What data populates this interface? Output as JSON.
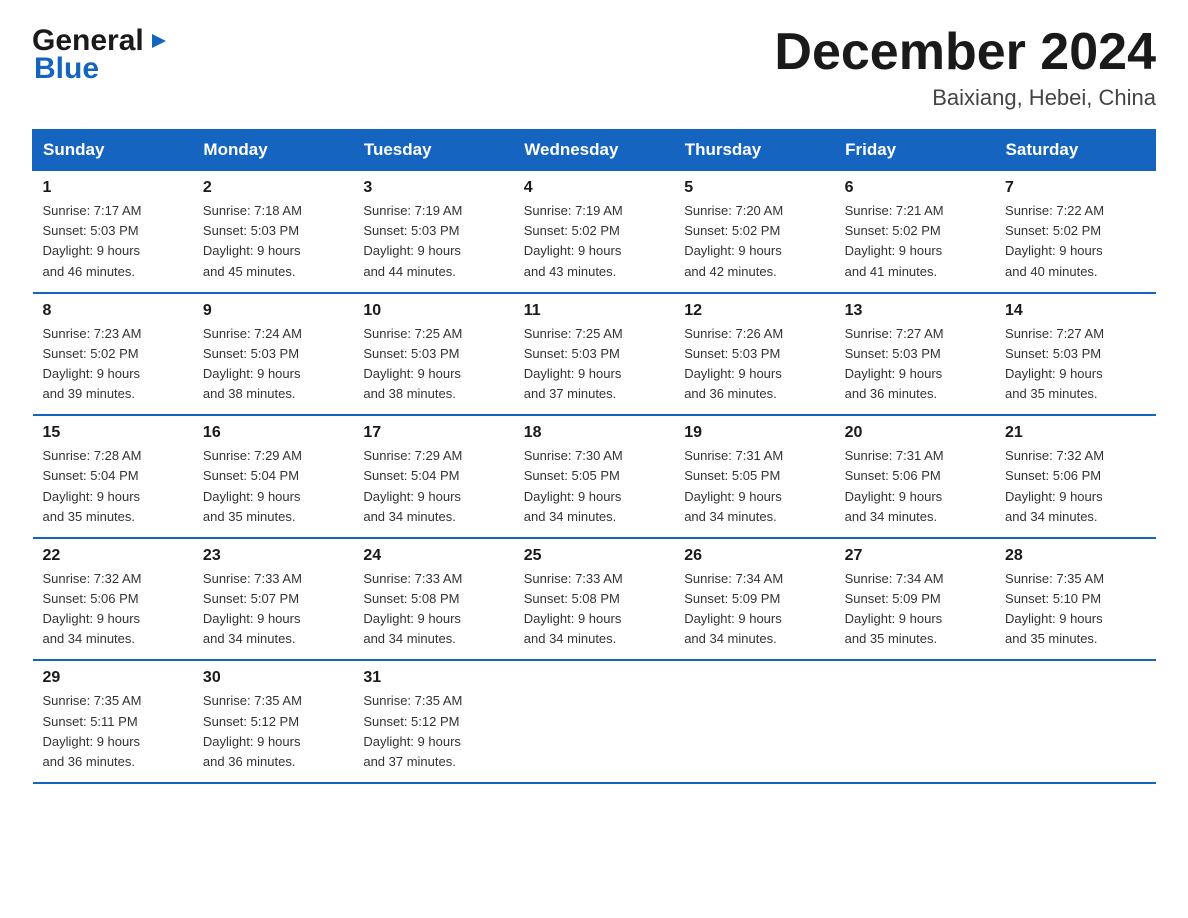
{
  "header": {
    "title": "December 2024",
    "subtitle": "Baixiang, Hebei, China"
  },
  "logo": {
    "general": "General",
    "blue": "Blue"
  },
  "calendar": {
    "headers": [
      "Sunday",
      "Monday",
      "Tuesday",
      "Wednesday",
      "Thursday",
      "Friday",
      "Saturday"
    ],
    "weeks": [
      [
        {
          "day": "1",
          "sunrise": "7:17 AM",
          "sunset": "5:03 PM",
          "daylight": "9 hours and 46 minutes."
        },
        {
          "day": "2",
          "sunrise": "7:18 AM",
          "sunset": "5:03 PM",
          "daylight": "9 hours and 45 minutes."
        },
        {
          "day": "3",
          "sunrise": "7:19 AM",
          "sunset": "5:03 PM",
          "daylight": "9 hours and 44 minutes."
        },
        {
          "day": "4",
          "sunrise": "7:19 AM",
          "sunset": "5:02 PM",
          "daylight": "9 hours and 43 minutes."
        },
        {
          "day": "5",
          "sunrise": "7:20 AM",
          "sunset": "5:02 PM",
          "daylight": "9 hours and 42 minutes."
        },
        {
          "day": "6",
          "sunrise": "7:21 AM",
          "sunset": "5:02 PM",
          "daylight": "9 hours and 41 minutes."
        },
        {
          "day": "7",
          "sunrise": "7:22 AM",
          "sunset": "5:02 PM",
          "daylight": "9 hours and 40 minutes."
        }
      ],
      [
        {
          "day": "8",
          "sunrise": "7:23 AM",
          "sunset": "5:02 PM",
          "daylight": "9 hours and 39 minutes."
        },
        {
          "day": "9",
          "sunrise": "7:24 AM",
          "sunset": "5:03 PM",
          "daylight": "9 hours and 38 minutes."
        },
        {
          "day": "10",
          "sunrise": "7:25 AM",
          "sunset": "5:03 PM",
          "daylight": "9 hours and 38 minutes."
        },
        {
          "day": "11",
          "sunrise": "7:25 AM",
          "sunset": "5:03 PM",
          "daylight": "9 hours and 37 minutes."
        },
        {
          "day": "12",
          "sunrise": "7:26 AM",
          "sunset": "5:03 PM",
          "daylight": "9 hours and 36 minutes."
        },
        {
          "day": "13",
          "sunrise": "7:27 AM",
          "sunset": "5:03 PM",
          "daylight": "9 hours and 36 minutes."
        },
        {
          "day": "14",
          "sunrise": "7:27 AM",
          "sunset": "5:03 PM",
          "daylight": "9 hours and 35 minutes."
        }
      ],
      [
        {
          "day": "15",
          "sunrise": "7:28 AM",
          "sunset": "5:04 PM",
          "daylight": "9 hours and 35 minutes."
        },
        {
          "day": "16",
          "sunrise": "7:29 AM",
          "sunset": "5:04 PM",
          "daylight": "9 hours and 35 minutes."
        },
        {
          "day": "17",
          "sunrise": "7:29 AM",
          "sunset": "5:04 PM",
          "daylight": "9 hours and 34 minutes."
        },
        {
          "day": "18",
          "sunrise": "7:30 AM",
          "sunset": "5:05 PM",
          "daylight": "9 hours and 34 minutes."
        },
        {
          "day": "19",
          "sunrise": "7:31 AM",
          "sunset": "5:05 PM",
          "daylight": "9 hours and 34 minutes."
        },
        {
          "day": "20",
          "sunrise": "7:31 AM",
          "sunset": "5:06 PM",
          "daylight": "9 hours and 34 minutes."
        },
        {
          "day": "21",
          "sunrise": "7:32 AM",
          "sunset": "5:06 PM",
          "daylight": "9 hours and 34 minutes."
        }
      ],
      [
        {
          "day": "22",
          "sunrise": "7:32 AM",
          "sunset": "5:06 PM",
          "daylight": "9 hours and 34 minutes."
        },
        {
          "day": "23",
          "sunrise": "7:33 AM",
          "sunset": "5:07 PM",
          "daylight": "9 hours and 34 minutes."
        },
        {
          "day": "24",
          "sunrise": "7:33 AM",
          "sunset": "5:08 PM",
          "daylight": "9 hours and 34 minutes."
        },
        {
          "day": "25",
          "sunrise": "7:33 AM",
          "sunset": "5:08 PM",
          "daylight": "9 hours and 34 minutes."
        },
        {
          "day": "26",
          "sunrise": "7:34 AM",
          "sunset": "5:09 PM",
          "daylight": "9 hours and 34 minutes."
        },
        {
          "day": "27",
          "sunrise": "7:34 AM",
          "sunset": "5:09 PM",
          "daylight": "9 hours and 35 minutes."
        },
        {
          "day": "28",
          "sunrise": "7:35 AM",
          "sunset": "5:10 PM",
          "daylight": "9 hours and 35 minutes."
        }
      ],
      [
        {
          "day": "29",
          "sunrise": "7:35 AM",
          "sunset": "5:11 PM",
          "daylight": "9 hours and 36 minutes."
        },
        {
          "day": "30",
          "sunrise": "7:35 AM",
          "sunset": "5:12 PM",
          "daylight": "9 hours and 36 minutes."
        },
        {
          "day": "31",
          "sunrise": "7:35 AM",
          "sunset": "5:12 PM",
          "daylight": "9 hours and 37 minutes."
        },
        null,
        null,
        null,
        null
      ]
    ]
  }
}
